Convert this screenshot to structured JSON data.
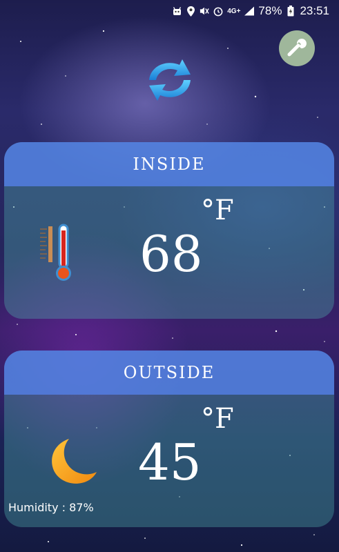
{
  "status_bar": {
    "network": "4G+",
    "battery": "78%",
    "time": "23:51"
  },
  "toolbar": {
    "settings_icon": "wrench-icon",
    "refresh_icon": "refresh-icon"
  },
  "inside": {
    "label": "INSIDE",
    "unit": "°F",
    "temperature": "68",
    "icon": "thermometer-icon"
  },
  "outside": {
    "label": "OUTSIDE",
    "unit": "°F",
    "temperature": "45",
    "icon": "moon-icon",
    "humidity": "Humidity : 87%"
  },
  "colors": {
    "header": "#5582eb",
    "card": "#50aaaa",
    "wrench_bg": "#9fb79b",
    "refresh": "#29a3e8",
    "moon": "#f5a51e"
  }
}
